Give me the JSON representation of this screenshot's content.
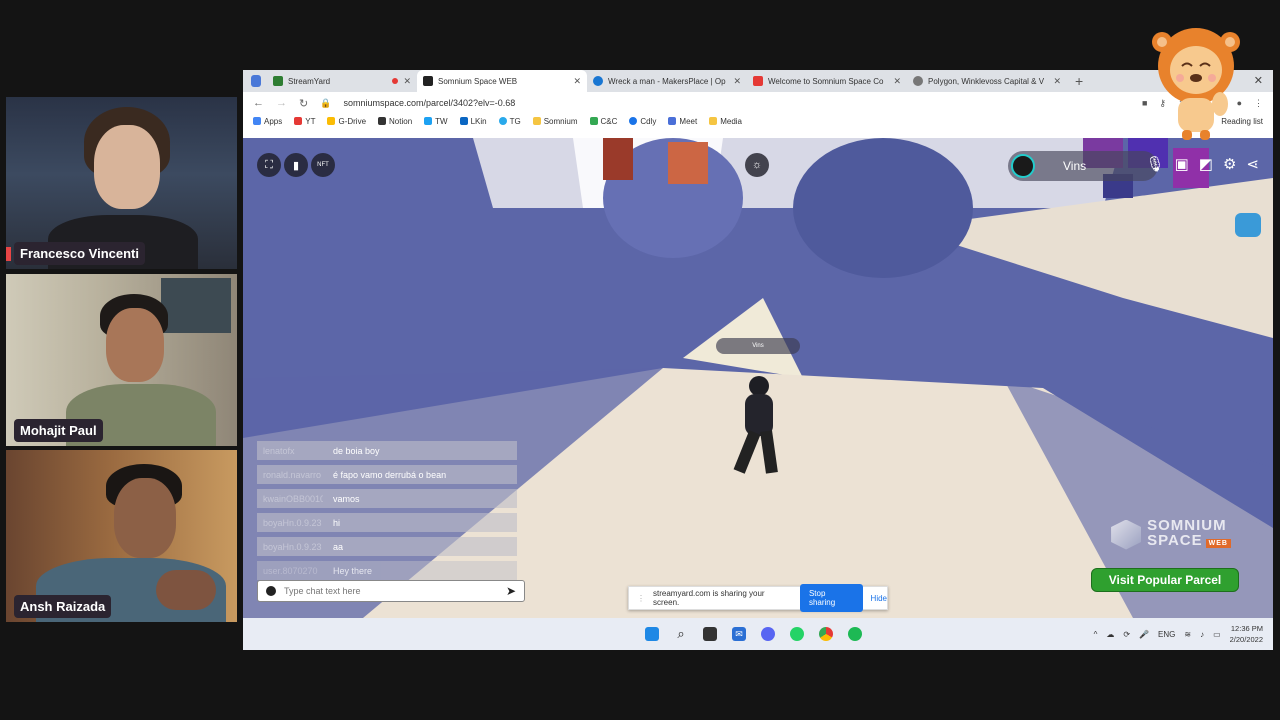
{
  "participants": [
    {
      "name": "Francesco Vincenti"
    },
    {
      "name": "Mohajit Paul"
    },
    {
      "name": "Ansh Raizada"
    }
  ],
  "browser": {
    "tabs": [
      {
        "title": "StreamYard",
        "color": "#2e7d32"
      },
      {
        "title": "Somnium Space WEB",
        "color": "#222222"
      },
      {
        "title": "Wreck a man - MakersPlace | Op",
        "color": "#1976d2"
      },
      {
        "title": "Welcome to Somnium Space Co",
        "color": "#e53935"
      },
      {
        "title": "Polygon, Winklevoss Capital & V",
        "color": "#555555"
      }
    ],
    "url": "somniumspace.com/parcel/3402?elv=-0.68",
    "bookmarks": [
      {
        "label": "Apps",
        "color": "#4285f4"
      },
      {
        "label": "YT",
        "color": "#e53935"
      },
      {
        "label": "G-Drive",
        "color": "#fbbc04"
      },
      {
        "label": "Notion",
        "color": "#333333"
      },
      {
        "label": "TW",
        "color": "#1da1f2"
      },
      {
        "label": "LKin",
        "color": "#0a66c2"
      },
      {
        "label": "TG",
        "color": "#29a9eb"
      },
      {
        "label": "Somnium",
        "color": "#f5c542"
      },
      {
        "label": "C&C",
        "color": "#34a853"
      },
      {
        "label": "Cdly",
        "color": "#1a73e8"
      },
      {
        "label": "Meet",
        "color": "#4a6fd8"
      },
      {
        "label": "Media",
        "color": "#f5c542"
      }
    ],
    "reading_list": "Reading list"
  },
  "scene": {
    "username": "Vins",
    "avatar_tag": "Vins",
    "chat": [
      {
        "user": "lenatofx",
        "msg": "de boia boy"
      },
      {
        "user": "ronald.navarro",
        "msg": "é fapo vamo derrubá o bean"
      },
      {
        "user": "kwainOBB0010",
        "msg": "vamos"
      },
      {
        "user": "boyaHn.0.9.23",
        "msg": "hi"
      },
      {
        "user": "boyaHn.0.9.23",
        "msg": "aa"
      },
      {
        "user": "user.8070270",
        "msg": "Hey there"
      }
    ],
    "chat_placeholder": "Type chat text here",
    "logo_line1": "SOMNIUM",
    "logo_line2": "SPACE",
    "logo_badge": "WEB",
    "visit_button": "Visit Popular Parcel",
    "share_text": "streamyard.com is sharing your screen.",
    "stop_sharing": "Stop sharing",
    "hide": "Hide"
  },
  "taskbar": {
    "language": "ENG",
    "time": "12:36 PM",
    "date": "2/20/2022"
  }
}
